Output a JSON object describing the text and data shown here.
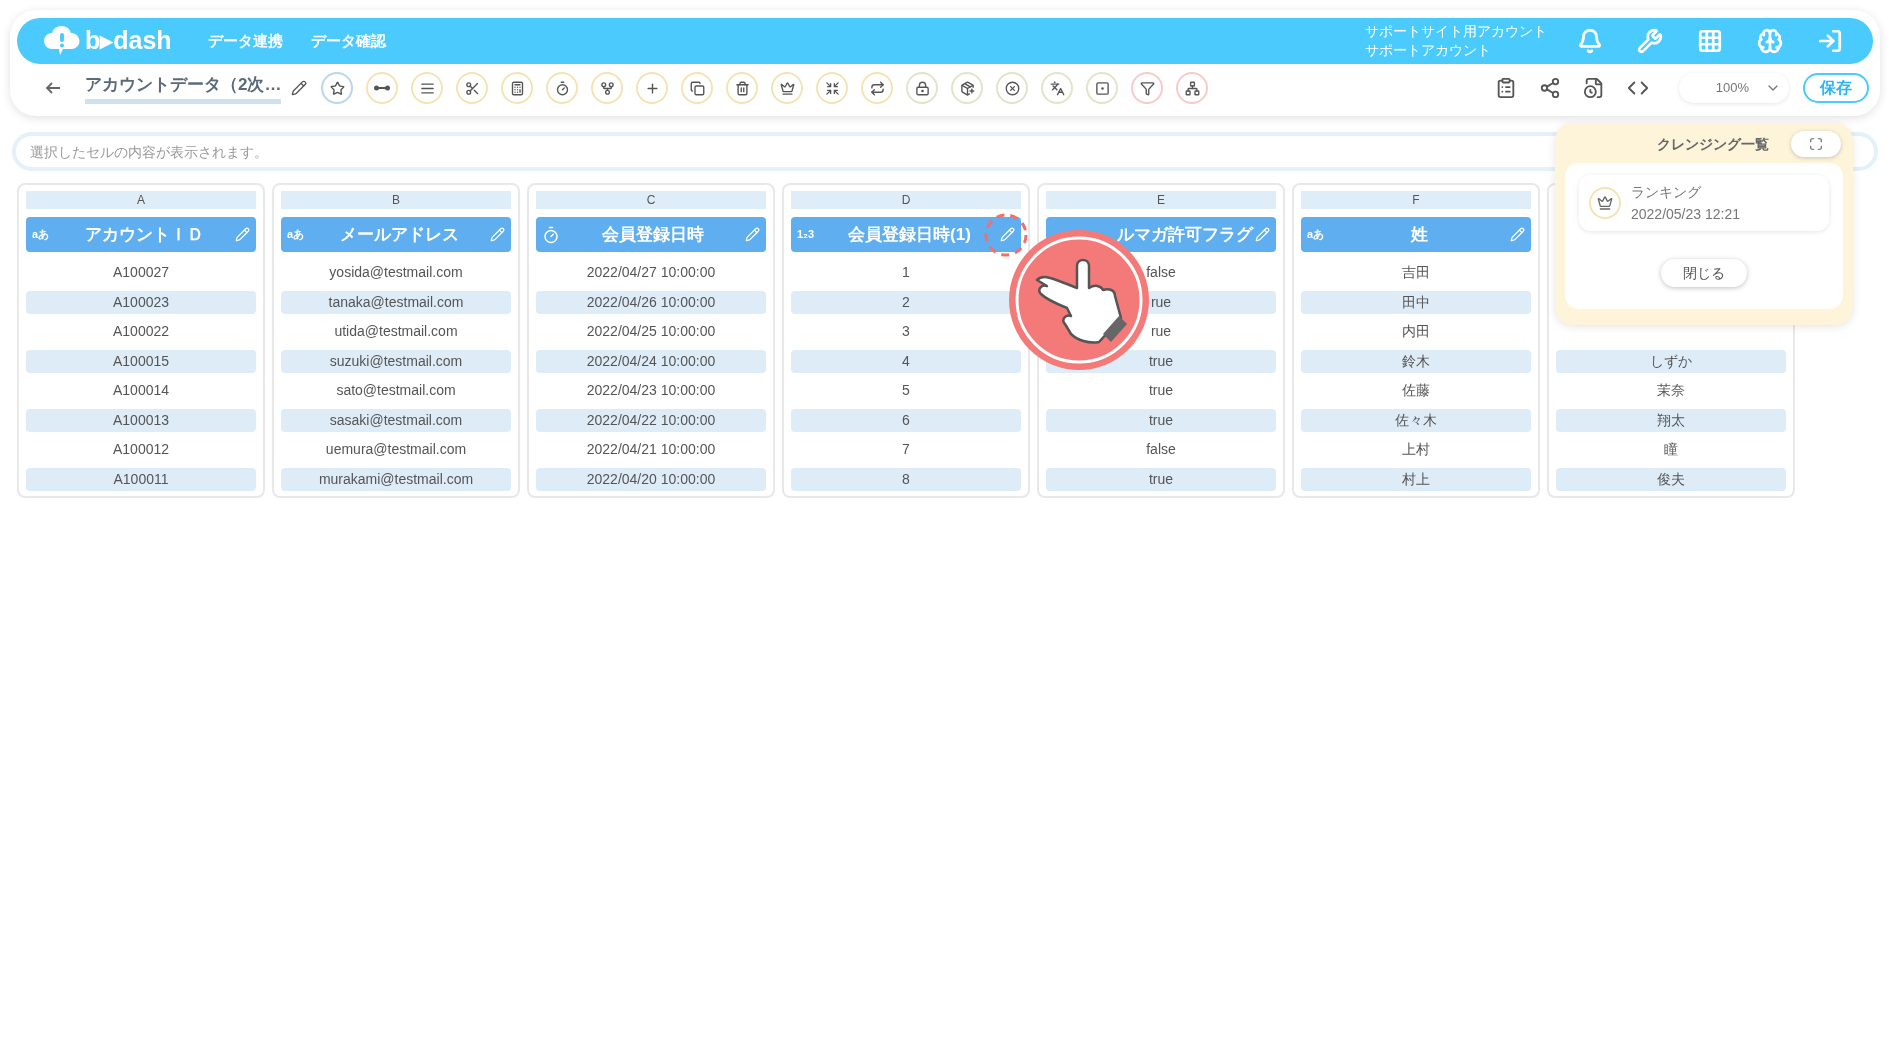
{
  "header": {
    "logo_text": "b▸dash",
    "nav": [
      "データ連携",
      "データ確認"
    ],
    "account_lines": [
      "サポートサイト用アカウント",
      "サポートアカウント"
    ]
  },
  "toolbar": {
    "title": "アカウントデータ（2次…",
    "tools": [
      {
        "color": "#b9d6ee"
      },
      {
        "color": "#f5e3b5"
      },
      {
        "color": "#f5e3b5"
      },
      {
        "color": "#f5e3b5"
      },
      {
        "color": "#f5e3b5"
      },
      {
        "color": "#f5e3b5"
      },
      {
        "color": "#f5e3b5"
      },
      {
        "color": "#f5e3b5"
      },
      {
        "color": "#f5e3b5"
      },
      {
        "color": "#f5e3b5"
      },
      {
        "color": "#f5e3b5"
      },
      {
        "color": "#f5e3b5"
      },
      {
        "color": "#f5e3b5"
      },
      {
        "color": "#dfe6c8"
      },
      {
        "color": "#dfe6c8"
      },
      {
        "color": "#dfe6c8"
      },
      {
        "color": "#dfe6c8"
      },
      {
        "color": "#dfe6c8"
      },
      {
        "color": "#f8caca"
      },
      {
        "color": "#f8caca"
      }
    ],
    "zoom": "100%",
    "save": "保存"
  },
  "cell_field": {
    "placeholder": "選択したセルの内容が表示されます。"
  },
  "columns": [
    {
      "letter": "A",
      "kind": "text",
      "type_label": "aあ",
      "name": "アカウントＩＤ",
      "cells": [
        "A100027",
        "A100023",
        "A100022",
        "A100015",
        "A100014",
        "A100013",
        "A100012",
        "A100011"
      ]
    },
    {
      "letter": "B",
      "kind": "text",
      "type_label": "aあ",
      "name": "メールアドレス",
      "cells": [
        "yosida@testmail.com",
        "tanaka@testmail.com",
        "utida@testmail.com",
        "suzuki@testmail.com",
        "sato@testmail.com",
        "sasaki@testmail.com",
        "uemura@testmail.com",
        "murakami@testmail.com"
      ]
    },
    {
      "letter": "C",
      "kind": "datetime",
      "name": "会員登録日時",
      "cells": [
        "2022/04/27 10:00:00",
        "2022/04/26 10:00:00",
        "2022/04/25 10:00:00",
        "2022/04/24 10:00:00",
        "2022/04/23 10:00:00",
        "2022/04/22 10:00:00",
        "2022/04/21 10:00:00",
        "2022/04/20 10:00:00"
      ]
    },
    {
      "letter": "D",
      "kind": "number",
      "type_label": "1₂3",
      "name": "会員登録日時(1)",
      "cells": [
        "1",
        "2",
        "3",
        "4",
        "5",
        "6",
        "7",
        "8"
      ]
    },
    {
      "letter": "E",
      "name": "ルマガ許可フラグ",
      "cells": [
        "false",
        "rue",
        "rue",
        "true",
        "true",
        "true",
        "false",
        "true"
      ]
    },
    {
      "letter": "F",
      "kind": "text",
      "type_label": "aあ",
      "name": "姓",
      "cells": [
        "吉田",
        "田中",
        "内田",
        "鈴木",
        "佐藤",
        "佐々木",
        "上村",
        "村上"
      ]
    },
    {
      "cells": [
        null,
        null,
        null,
        "しずか",
        "茉奈",
        "翔太",
        "瞳",
        "俊夫"
      ]
    }
  ],
  "cleansing_panel": {
    "title": "クレンジング一覧",
    "items": [
      {
        "name": "ランキング",
        "date": "2022/05/23 12:21"
      }
    ],
    "close": "閉じる"
  }
}
